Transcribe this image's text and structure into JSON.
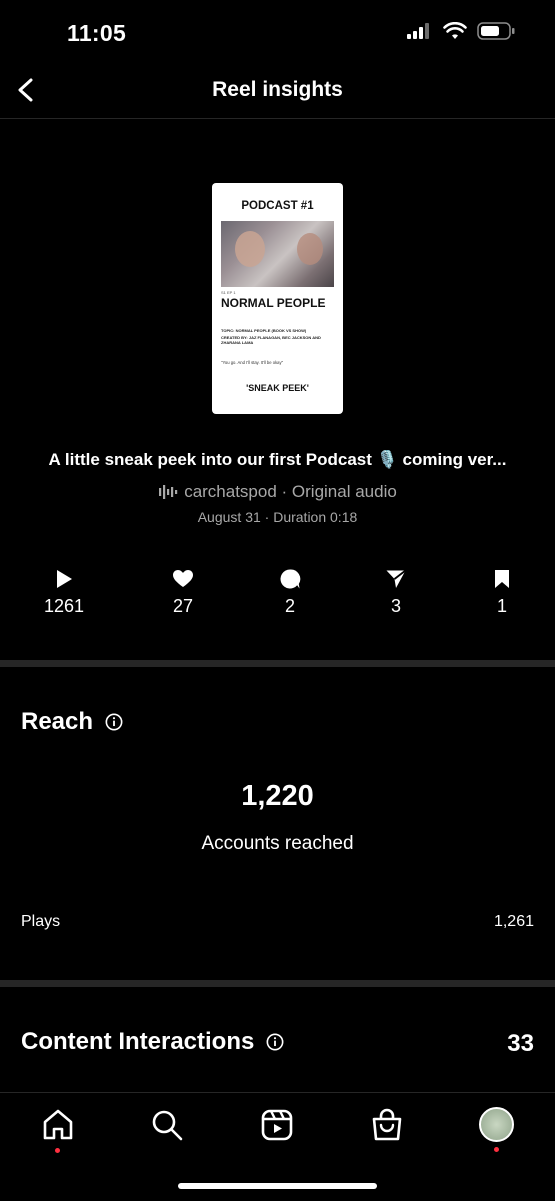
{
  "status_bar": {
    "time": "11:05"
  },
  "header": {
    "title": "Reel insights"
  },
  "reel": {
    "thumbnail": {
      "title": "PODCAST #1",
      "episode": "S1 EP 1",
      "headline": "NORMAL PEOPLE",
      "topic": "TOPIC: NORMAL PEOPLE (BOOK VS SHOW)",
      "created_by": "CREATED BY: JAZ FLANAGAN, BEC JACKSON AND ZHARANA LAMA",
      "quote": "\"You go. And I'll stay. It'll be okay\"",
      "tag": "'SNEAK PEEK'"
    },
    "caption": "A little sneak peek into our first Podcast 🎙️ coming ver...",
    "audio": "carchatspod · Original audio",
    "meta": "August 31 · Duration 0:18"
  },
  "stats": {
    "plays": "1261",
    "likes": "27",
    "comments": "2",
    "shares": "3",
    "saves": "1"
  },
  "reach": {
    "title": "Reach",
    "accounts_value": "1,220",
    "accounts_label": "Accounts reached",
    "plays_label": "Plays",
    "plays_value": "1,261"
  },
  "content_interactions": {
    "title": "Content Interactions",
    "value": "33"
  },
  "colors": {
    "background": "#000000",
    "text": "#ffffff",
    "muted": "#a8a8a8",
    "divider": "#262626",
    "notification": "#ff3040"
  },
  "icons": [
    "back-chevron",
    "play",
    "heart",
    "comment",
    "share",
    "bookmark",
    "info",
    "home",
    "search",
    "reels",
    "shop"
  ]
}
